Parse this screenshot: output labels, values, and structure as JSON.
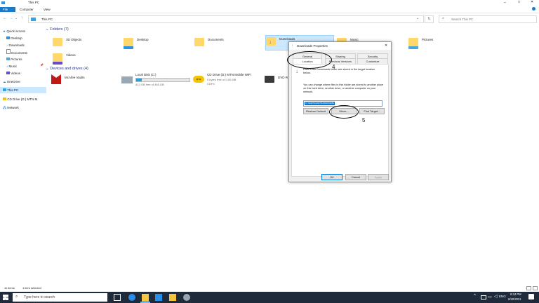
{
  "window": {
    "title": "This PC"
  },
  "ribbon": {
    "tabs": [
      "File",
      "Computer",
      "View"
    ]
  },
  "address": {
    "path": "This PC",
    "search_placeholder": "Search This PC"
  },
  "nav": {
    "items": [
      {
        "label": "Quick access"
      },
      {
        "label": "Desktop"
      },
      {
        "label": "Downloads"
      },
      {
        "label": "Documents"
      },
      {
        "label": "Pictures"
      },
      {
        "label": "Music"
      },
      {
        "label": "Videos"
      },
      {
        "label": "OneDrive"
      },
      {
        "label": "This PC"
      },
      {
        "label": "CD Drive (D:) MTN M"
      },
      {
        "label": "Network"
      }
    ]
  },
  "folders": {
    "heading": "Folders (7)",
    "items": [
      {
        "label": "3D Objects"
      },
      {
        "label": "Desktop"
      },
      {
        "label": "Documents"
      },
      {
        "label": "Downloads"
      },
      {
        "label": "Music"
      },
      {
        "label": "Pictures"
      },
      {
        "label": "Videos"
      }
    ]
  },
  "devices": {
    "heading": "Devices and drives (4)",
    "mcafee": "McAfee Vaults",
    "local_disk": {
      "name": "Local Disk (C:)",
      "free": "413 GB free of 465 GB",
      "used_fraction": 0.11
    },
    "cd_drive": {
      "name": "CD Drive (D:) MTN Mobile WiFi",
      "free": "0 bytes free of 0.00 MB",
      "fs": "CDFS"
    },
    "dvd": "DVD R"
  },
  "status": {
    "items": "11 items",
    "selected": "1 item selected"
  },
  "dialog": {
    "title": "Downloads Properties",
    "tabs_top": [
      "General",
      "Sharing",
      "Security"
    ],
    "tabs_bottom": [
      "Location",
      "Previous Versions",
      "Customize"
    ],
    "desc1": "Files in the Downloads folder are stored in the target location below.",
    "desc2": "You can change where files in this folder are stored to another place on this hard drive, another drive, or another computer on your network.",
    "path_value": "C:\\Users\\user\\Downloads",
    "restore_label": "Restore Default",
    "move_label": "Move...",
    "find_label": "Find Target...",
    "ok_label": "OK",
    "cancel_label": "Cancel",
    "apply_label": "Apply"
  },
  "annotations": {
    "step4": "4",
    "step5": "5"
  },
  "taskbar": {
    "search_placeholder": "Type here to search",
    "lang": "ENG",
    "time": "8:34 PM",
    "date": "6/20/2021"
  }
}
